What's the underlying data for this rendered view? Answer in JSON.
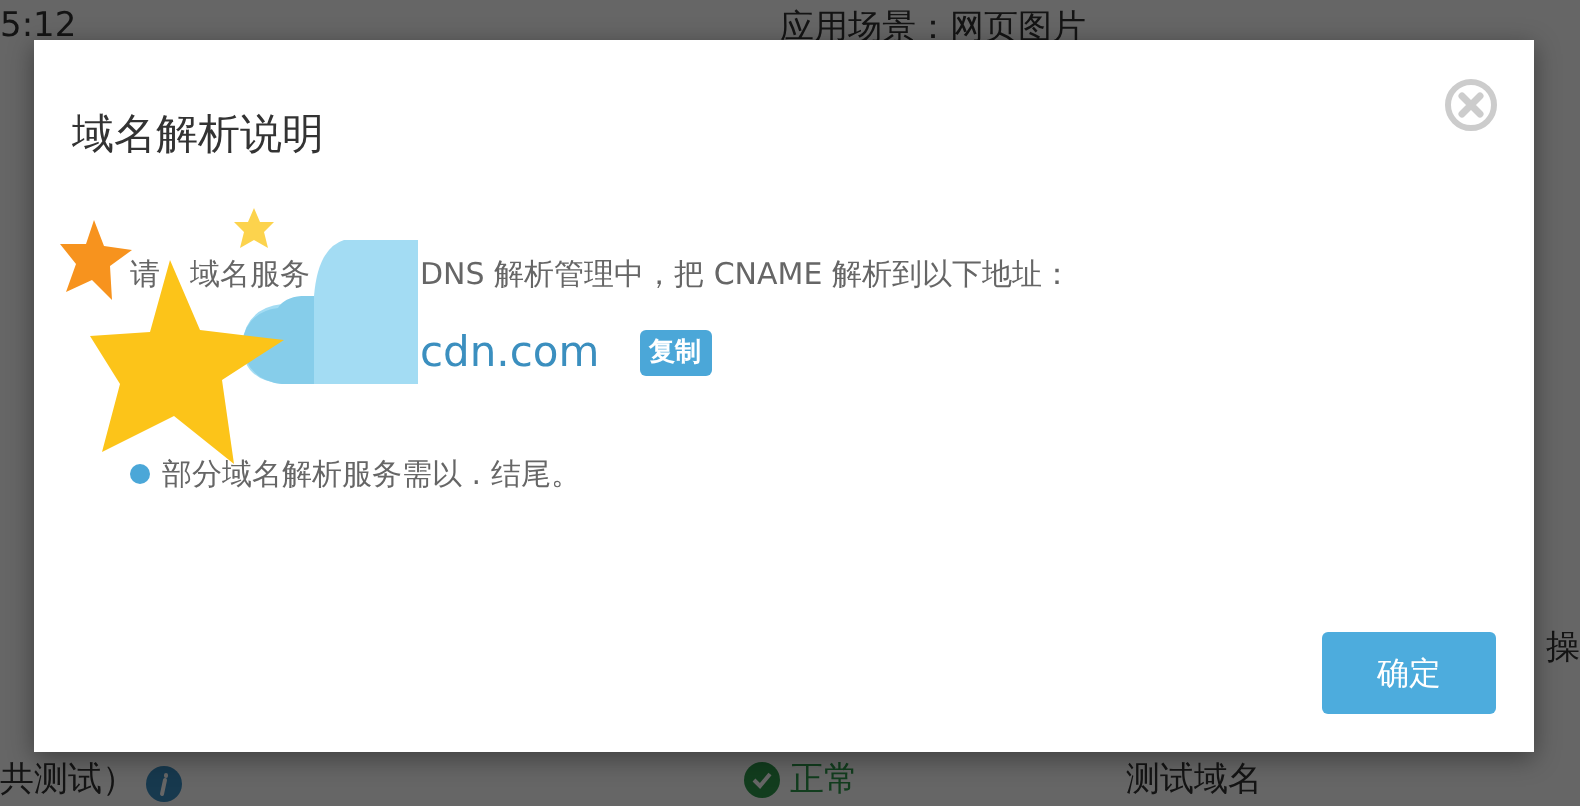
{
  "page_behind": {
    "time": "5:12",
    "scene": "应用场景：网页图片",
    "column_header": "操",
    "row": {
      "name": "共测试）",
      "status": "正常",
      "domain_type": "测试域名"
    }
  },
  "dialog": {
    "title": "域名解析说明",
    "instruction_parts": [
      "请",
      "域名服务",
      "DNS 解析管理中，把 CNAME 解析到以下地址："
    ],
    "address": "cdn.com",
    "copy_button": "复制",
    "notes": [
      "部分域名解析服务需以 . 结尾。"
    ],
    "ok_button": "确定"
  }
}
